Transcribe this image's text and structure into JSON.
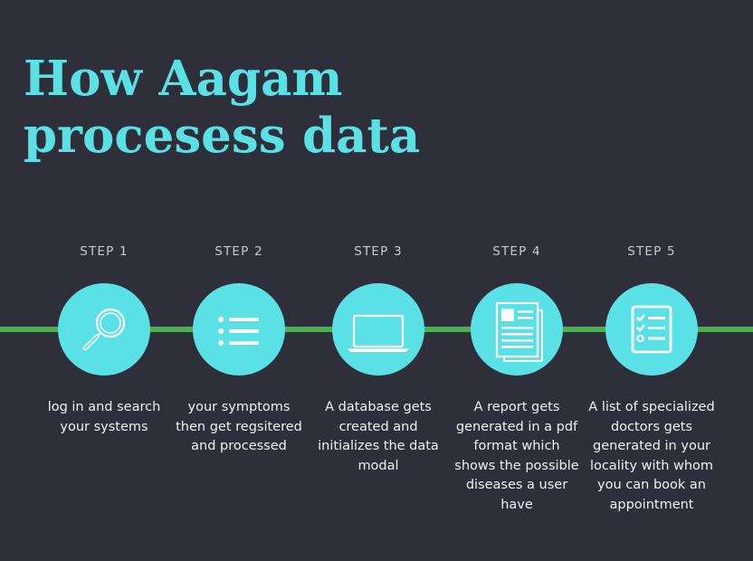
{
  "title": {
    "line1": "How Aagam",
    "line2": "procesess data"
  },
  "colors": {
    "background": "#2f2f3b",
    "accent": "#5ae1e6",
    "timeline": "#4caf50"
  },
  "steps": [
    {
      "label": "STEP 1",
      "icon": "magnifier-icon",
      "description": "log in and search your systems"
    },
    {
      "label": "STEP 2",
      "icon": "list-icon",
      "description": "your symptoms then get regsitered and processed"
    },
    {
      "label": "STEP 3",
      "icon": "laptop-icon",
      "description": "A database gets created and initializes the data modal"
    },
    {
      "label": "STEP 4",
      "icon": "document-icon",
      "description": "A report gets generated in a pdf format which shows the possible diseases a user have"
    },
    {
      "label": "STEP 5",
      "icon": "checklist-icon",
      "description": "A list of specialized doctors gets generated in your locality with whom you can book an appointment"
    }
  ]
}
